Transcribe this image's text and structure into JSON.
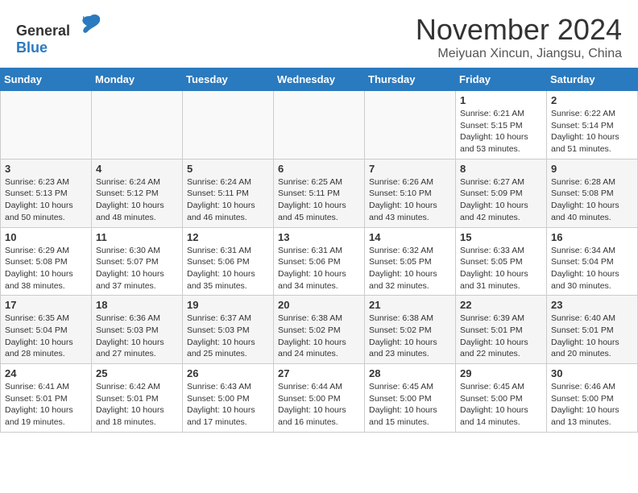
{
  "header": {
    "logo_general": "General",
    "logo_blue": "Blue",
    "month_title": "November 2024",
    "location": "Meiyuan Xincun, Jiangsu, China"
  },
  "weekdays": [
    "Sunday",
    "Monday",
    "Tuesday",
    "Wednesday",
    "Thursday",
    "Friday",
    "Saturday"
  ],
  "weeks": [
    [
      {
        "day": "",
        "info": ""
      },
      {
        "day": "",
        "info": ""
      },
      {
        "day": "",
        "info": ""
      },
      {
        "day": "",
        "info": ""
      },
      {
        "day": "",
        "info": ""
      },
      {
        "day": "1",
        "info": "Sunrise: 6:21 AM\nSunset: 5:15 PM\nDaylight: 10 hours\nand 53 minutes."
      },
      {
        "day": "2",
        "info": "Sunrise: 6:22 AM\nSunset: 5:14 PM\nDaylight: 10 hours\nand 51 minutes."
      }
    ],
    [
      {
        "day": "3",
        "info": "Sunrise: 6:23 AM\nSunset: 5:13 PM\nDaylight: 10 hours\nand 50 minutes."
      },
      {
        "day": "4",
        "info": "Sunrise: 6:24 AM\nSunset: 5:12 PM\nDaylight: 10 hours\nand 48 minutes."
      },
      {
        "day": "5",
        "info": "Sunrise: 6:24 AM\nSunset: 5:11 PM\nDaylight: 10 hours\nand 46 minutes."
      },
      {
        "day": "6",
        "info": "Sunrise: 6:25 AM\nSunset: 5:11 PM\nDaylight: 10 hours\nand 45 minutes."
      },
      {
        "day": "7",
        "info": "Sunrise: 6:26 AM\nSunset: 5:10 PM\nDaylight: 10 hours\nand 43 minutes."
      },
      {
        "day": "8",
        "info": "Sunrise: 6:27 AM\nSunset: 5:09 PM\nDaylight: 10 hours\nand 42 minutes."
      },
      {
        "day": "9",
        "info": "Sunrise: 6:28 AM\nSunset: 5:08 PM\nDaylight: 10 hours\nand 40 minutes."
      }
    ],
    [
      {
        "day": "10",
        "info": "Sunrise: 6:29 AM\nSunset: 5:08 PM\nDaylight: 10 hours\nand 38 minutes."
      },
      {
        "day": "11",
        "info": "Sunrise: 6:30 AM\nSunset: 5:07 PM\nDaylight: 10 hours\nand 37 minutes."
      },
      {
        "day": "12",
        "info": "Sunrise: 6:31 AM\nSunset: 5:06 PM\nDaylight: 10 hours\nand 35 minutes."
      },
      {
        "day": "13",
        "info": "Sunrise: 6:31 AM\nSunset: 5:06 PM\nDaylight: 10 hours\nand 34 minutes."
      },
      {
        "day": "14",
        "info": "Sunrise: 6:32 AM\nSunset: 5:05 PM\nDaylight: 10 hours\nand 32 minutes."
      },
      {
        "day": "15",
        "info": "Sunrise: 6:33 AM\nSunset: 5:05 PM\nDaylight: 10 hours\nand 31 minutes."
      },
      {
        "day": "16",
        "info": "Sunrise: 6:34 AM\nSunset: 5:04 PM\nDaylight: 10 hours\nand 30 minutes."
      }
    ],
    [
      {
        "day": "17",
        "info": "Sunrise: 6:35 AM\nSunset: 5:04 PM\nDaylight: 10 hours\nand 28 minutes."
      },
      {
        "day": "18",
        "info": "Sunrise: 6:36 AM\nSunset: 5:03 PM\nDaylight: 10 hours\nand 27 minutes."
      },
      {
        "day": "19",
        "info": "Sunrise: 6:37 AM\nSunset: 5:03 PM\nDaylight: 10 hours\nand 25 minutes."
      },
      {
        "day": "20",
        "info": "Sunrise: 6:38 AM\nSunset: 5:02 PM\nDaylight: 10 hours\nand 24 minutes."
      },
      {
        "day": "21",
        "info": "Sunrise: 6:38 AM\nSunset: 5:02 PM\nDaylight: 10 hours\nand 23 minutes."
      },
      {
        "day": "22",
        "info": "Sunrise: 6:39 AM\nSunset: 5:01 PM\nDaylight: 10 hours\nand 22 minutes."
      },
      {
        "day": "23",
        "info": "Sunrise: 6:40 AM\nSunset: 5:01 PM\nDaylight: 10 hours\nand 20 minutes."
      }
    ],
    [
      {
        "day": "24",
        "info": "Sunrise: 6:41 AM\nSunset: 5:01 PM\nDaylight: 10 hours\nand 19 minutes."
      },
      {
        "day": "25",
        "info": "Sunrise: 6:42 AM\nSunset: 5:01 PM\nDaylight: 10 hours\nand 18 minutes."
      },
      {
        "day": "26",
        "info": "Sunrise: 6:43 AM\nSunset: 5:00 PM\nDaylight: 10 hours\nand 17 minutes."
      },
      {
        "day": "27",
        "info": "Sunrise: 6:44 AM\nSunset: 5:00 PM\nDaylight: 10 hours\nand 16 minutes."
      },
      {
        "day": "28",
        "info": "Sunrise: 6:45 AM\nSunset: 5:00 PM\nDaylight: 10 hours\nand 15 minutes."
      },
      {
        "day": "29",
        "info": "Sunrise: 6:45 AM\nSunset: 5:00 PM\nDaylight: 10 hours\nand 14 minutes."
      },
      {
        "day": "30",
        "info": "Sunrise: 6:46 AM\nSunset: 5:00 PM\nDaylight: 10 hours\nand 13 minutes."
      }
    ]
  ]
}
